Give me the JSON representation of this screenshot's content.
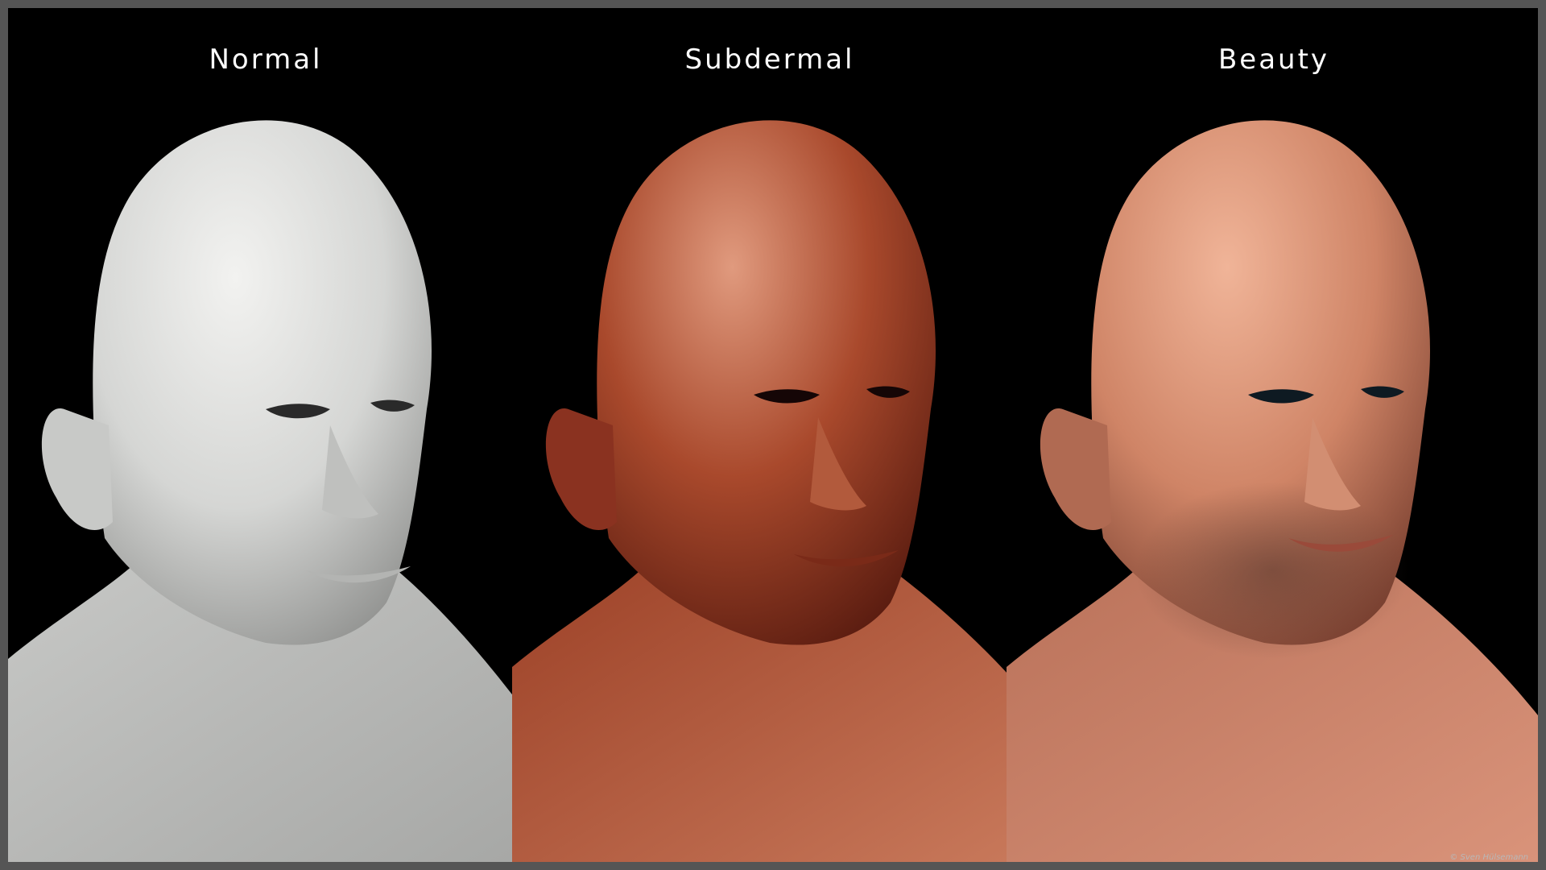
{
  "panels": [
    {
      "label": "Normal",
      "shader": "grey-clay"
    },
    {
      "label": "Subdermal",
      "shader": "subdermal-red"
    },
    {
      "label": "Beauty",
      "shader": "final-skin"
    }
  ],
  "credit": "© Sven Hülsemann",
  "colors": {
    "background": "#000000",
    "border": "#555555",
    "label": "#ffffff",
    "normal_skin": "#d9dad8",
    "subdermal_skin": "#a2442a",
    "beauty_skin": "#d08466"
  }
}
